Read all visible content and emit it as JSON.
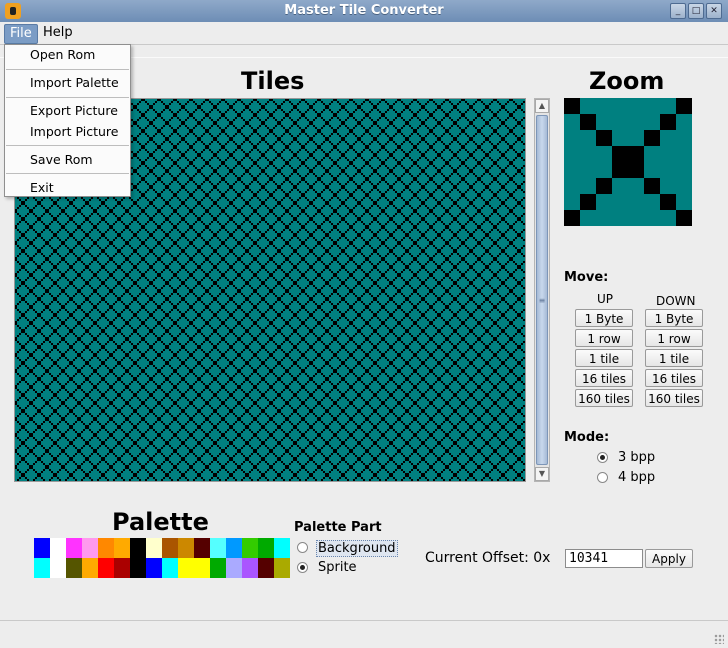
{
  "window": {
    "title": "Master Tile Converter",
    "buttons": [
      "_",
      "□",
      "✕"
    ]
  },
  "menubar": {
    "items": [
      "File",
      "Help"
    ]
  },
  "file_menu": {
    "items": [
      "Open Rom",
      "Import Palette",
      "Export Picture",
      "Import Picture",
      "Save Rom",
      "Exit"
    ]
  },
  "tiles": {
    "heading": "Tiles"
  },
  "zoom": {
    "heading": "Zoom"
  },
  "move": {
    "label": "Move:",
    "up_label": "UP",
    "down_label": "DOWN",
    "up_buttons": [
      "1 Byte",
      "1 row",
      "1 tile",
      "16 tiles",
      "160 tiles"
    ],
    "down_buttons": [
      "1 Byte",
      "1 row",
      "1 tile",
      "16 tiles",
      "160 tiles"
    ]
  },
  "mode": {
    "label": "Mode:",
    "options": [
      "3 bpp",
      "4 bpp"
    ],
    "selected": "3 bpp"
  },
  "palette": {
    "heading": "Palette",
    "row1": [
      "#0000ff",
      "#ffffff",
      "#ff33ff",
      "#ff99ee",
      "#ff8800",
      "#ffaa00",
      "#000000",
      "#ffffcc",
      "#aa5500",
      "#cc8800",
      "#550000",
      "#55ffff",
      "#0099ff",
      "#33cc00",
      "#00aa00",
      "#00ffff"
    ],
    "row2": [
      "#00ffff",
      "#ffffff",
      "#555500",
      "#ffaa00",
      "#ff0000",
      "#aa0000",
      "#000000",
      "#0000ff",
      "#00ffff",
      "#ffff00",
      "#ffff00",
      "#00aa00",
      "#aaaaff",
      "#aa55ff",
      "#550000",
      "#aaaa00"
    ]
  },
  "palette_part": {
    "label": "Palette Part",
    "options": [
      "Background",
      "Sprite"
    ],
    "selected": "Sprite"
  },
  "offset": {
    "label": "Current Offset: 0x",
    "value": "10341",
    "apply_label": "Apply"
  },
  "colors": {
    "tile_bg": "#008080",
    "tile_fg": "#000000",
    "menu_highlight": "#7b9cc5"
  }
}
